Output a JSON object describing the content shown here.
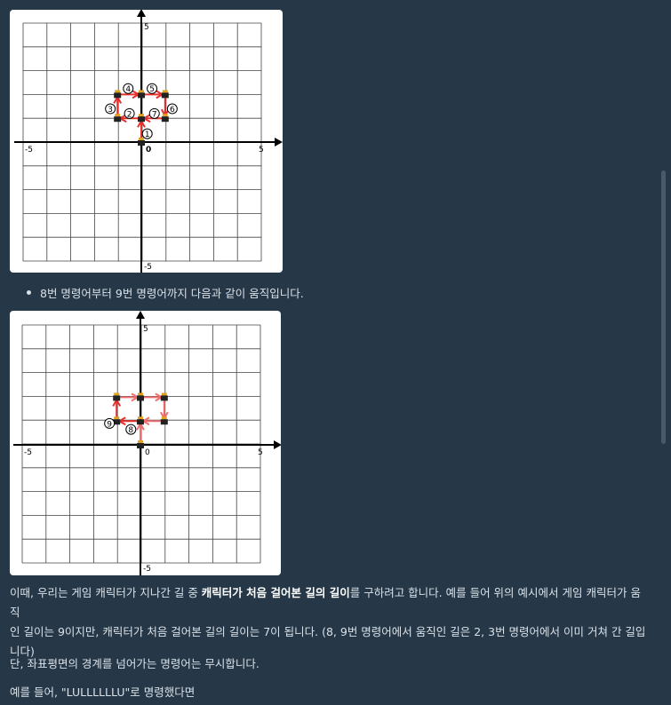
{
  "figure1": {
    "axis_labels": {
      "y_top": "5",
      "y_bottom": "-5",
      "x_left": "-5",
      "x_right": "5",
      "origin": "0"
    },
    "markers": [
      "①",
      "②",
      "③",
      "④",
      "⑤",
      "⑥",
      "⑦"
    ]
  },
  "figure2": {
    "axis_labels": {
      "y_top": "5",
      "y_bottom": "-5",
      "x_left": "-5",
      "x_right": "5",
      "origin": "0"
    },
    "markers": [
      "⑧",
      "⑨"
    ]
  },
  "bullet_text": "8번 명령어부터 9번 명령어까지 다음과 같이 움직입니다.",
  "para1": {
    "before": "이때, 우리는 게임 캐릭터가 지나간 길 중 ",
    "bold": "캐릭터가 처음 걸어본 길의 길이",
    "after": "를 구하려고 합니다. 예를 들어 위의 예시에서 게임 캐릭터가 움직",
    "line2": "인 길이는 9이지만, 캐릭터가 처음 걸어본 길의 길이는 7이 됩니다. (8, 9번 명령어에서 움직인 길은 2, 3번 명령어에서 이미 거쳐 간 길입",
    "line3": "니다)"
  },
  "para2": "단, 좌표평면의 경계를 넘어가는 명령어는 무시합니다.",
  "para3": "예를 들어, \"LULLLLLLU\"로 명령했다면",
  "colors": {
    "background": "#263747",
    "path_red": "#e8312f",
    "path_pink": "#f07070"
  }
}
